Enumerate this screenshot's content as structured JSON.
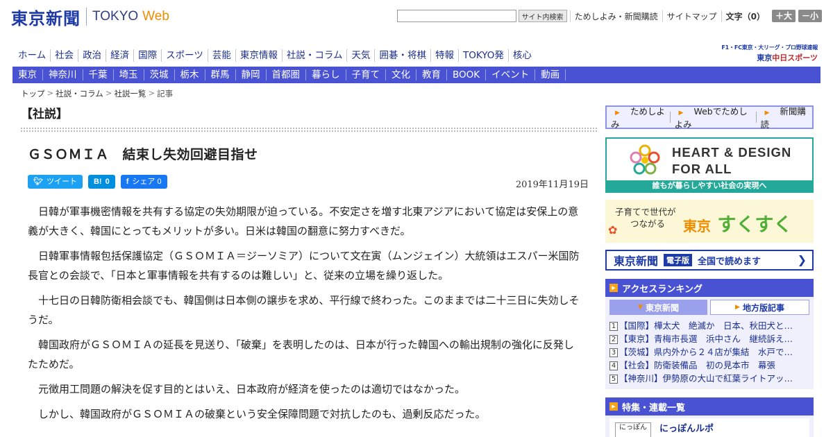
{
  "header": {
    "logo_jp": "東京新聞",
    "logo_en": "TOKYO",
    "logo_web": "Web",
    "search_button": "サイト内検索",
    "links": [
      "ためしよみ・新聞購読",
      "サイトマップ"
    ],
    "font_label": "文字",
    "font_value": "（0）",
    "font_larger": "＋大",
    "font_smaller": "－小"
  },
  "nav_main": [
    "ホーム",
    "社会",
    "政治",
    "経済",
    "国際",
    "スポーツ",
    "芸能",
    "東京情報",
    "社説・コラム",
    "天気",
    "囲碁・将棋",
    "特報",
    "TOKYO発",
    "核心"
  ],
  "chunichi": {
    "top": "F1・FC東京・大リーグ・プロ野球速報",
    "brand_prefix": "東京",
    "brand_red": "中日スポーツ"
  },
  "nav_region": [
    "東京",
    "神奈川",
    "千葉",
    "埼玉",
    "茨城",
    "栃木",
    "群馬",
    "静岡",
    "首都圏",
    "暮らし",
    "子育て",
    "文化",
    "教育",
    "BOOK",
    "イベント",
    "動画"
  ],
  "breadcrumb": [
    "トップ",
    "社説・コラム",
    "社説一覧",
    "記事"
  ],
  "article": {
    "section": "【社説】",
    "headline": "ＧＳＯＭＩＡ　結束し失効回避目指せ",
    "share": {
      "tweet": "ツイート",
      "hatena_icon": "B!",
      "hatena_count": "0",
      "facebook_icon": "f",
      "facebook_label": "シェア",
      "facebook_count": "0"
    },
    "date": "2019年11月19日",
    "paragraphs": [
      "日韓が軍事機密情報を共有する協定の失効期限が迫っている。不安定さを増す北東アジアにおいて協定は安保上の意義が大きく、韓国にとってもメリットが多い。日米は韓国の翻意に努力すべきだ。",
      "日韓軍事情報包括保護協定（ＧＳＯＭＩＡ＝ジーソミア）について文在寅（ムンジェイン）大統領はエスパー米国防長官との会談で、「日本と軍事情報を共有するのは難しい」と、従来の立場を繰り返した。",
      "十七日の日韓防衛相会談でも、韓国側は日本側の譲歩を求め、平行線で終わった。このままでは二十三日に失効しそうだ。",
      "韓国政府がＧＳＯＭＩＡの延長を見送り、「破棄」を表明したのは、日本が行った韓国への輸出規制の強化に反発したためだ。",
      "元徴用工問題の解決を促す目的とはいえ、日本政府が経済を使ったのは適切ではなかった。",
      "しかし、韓国政府がＧＳＯＭＩＡの破棄という安全保障問題で対抗したのも、過剰反応だった。"
    ]
  },
  "side": {
    "promo": [
      "ためしよみ",
      "Webでためしよみ",
      "新聞購読"
    ],
    "heart": {
      "line1": "HEART & DESIGN",
      "line2": "FOR ALL",
      "bar": "誰もが暮らしやすい社会の実現へ"
    },
    "sukusuku": {
      "sub1": "子育てで世代が",
      "sub2": "つながる",
      "tokyo": "東京",
      "main": "すくすく"
    },
    "ebook": {
      "logo": "東京新聞",
      "tag": "電子版",
      "text": "全国で読めます"
    },
    "ranking": {
      "title": "アクセスランキング",
      "tab_active": "東京新聞",
      "tab_inactive": "地方版記事",
      "items": [
        {
          "num": "1",
          "text": "【国際】樺太犬　絶滅か　日本、秋田犬と…"
        },
        {
          "num": "2",
          "text": "【東京】青梅市長選　浜中さん　継続訴え…"
        },
        {
          "num": "3",
          "text": "【茨城】県内外から２４店が集結　水戸で…"
        },
        {
          "num": "4",
          "text": "【社会】防衛装備品　初の見本市　幕張"
        },
        {
          "num": "5",
          "text": "【神奈川】伊勢原の大山で紅葉ライトアッ…"
        }
      ]
    },
    "feature": {
      "title": "特集・連載一覧",
      "thumb": "にっぽん",
      "item_title": "にっぽんルポ"
    }
  },
  "colors": {
    "brand_blue": "#1d3aa6",
    "nav_bar": "#4a52d4",
    "accent_orange": "#f08c00",
    "heart_teal": "#23a89a"
  }
}
